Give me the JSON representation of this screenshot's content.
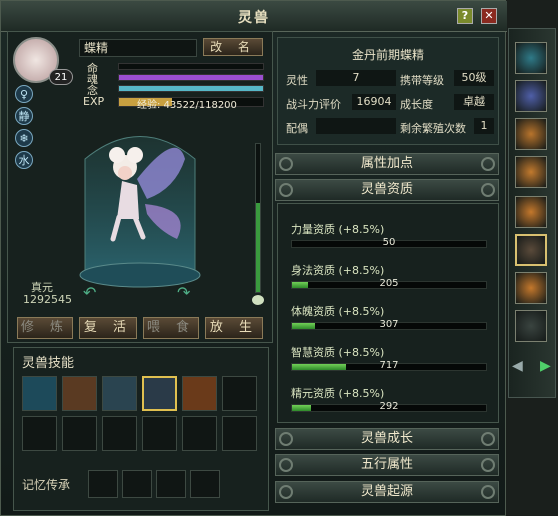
{
  "window": {
    "title": "灵兽",
    "help_label": "?",
    "close_label": "✕"
  },
  "pet": {
    "level": "21",
    "name": "蝶精",
    "rename_label": "改 名",
    "stats": [
      {
        "label": "命",
        "fill": 0.0,
        "color": "#b0484a"
      },
      {
        "label": "魂",
        "fill": 1.0,
        "color": "#9a4fd0"
      },
      {
        "label": "念",
        "fill": 1.0,
        "color": "#57b8c8"
      },
      {
        "label": "EXP",
        "fill": 0.37,
        "color": "#c8a040"
      }
    ],
    "exp_text": "经验: 43522/118200",
    "zhenyuan_label": "真元",
    "zhenyuan_value": "1292545",
    "attr_icons": [
      "♀",
      "静",
      "❄",
      "水"
    ]
  },
  "actions": {
    "train": "修 炼",
    "revive": "复 活",
    "feed": "喂 食",
    "release": "放 生"
  },
  "skills": {
    "title": "灵兽技能",
    "memory_label": "记忆传承"
  },
  "info": {
    "realm": "金丹前期蝶精",
    "spirit_label": "灵性",
    "spirit_value": "7",
    "carry_label": "携带等级",
    "carry_value": "50级",
    "power_label": "战斗力评价",
    "power_value": "16904",
    "growth_label": "成长度",
    "growth_value": "卓越",
    "mate_label": "配偶",
    "mate_value": "",
    "breed_label": "剩余繁殖次数",
    "breed_value": "1"
  },
  "sections": {
    "attr_points": "属性加点",
    "aptitude": "灵兽资质",
    "growth": "灵兽成长",
    "elements": "五行属性",
    "origin": "灵兽起源"
  },
  "aptitudes": [
    {
      "label": "力量资质 (+8.5%)",
      "value": "50",
      "fill": 0.0
    },
    {
      "label": "身法资质 (+8.5%)",
      "value": "205",
      "fill": 0.08
    },
    {
      "label": "体魄资质 (+8.5%)",
      "value": "307",
      "fill": 0.12
    },
    {
      "label": "智慧资质 (+8.5%)",
      "value": "717",
      "fill": 0.28
    },
    {
      "label": "精元资质 (+8.5%)",
      "value": "292",
      "fill": 0.1
    }
  ],
  "side_pets": [
    "#2f7a88",
    "#4f5fa8",
    "#b8742c",
    "#c27a2e",
    "#c4782c",
    "#5a4a3a",
    "#c4782c",
    "#3a4440"
  ]
}
